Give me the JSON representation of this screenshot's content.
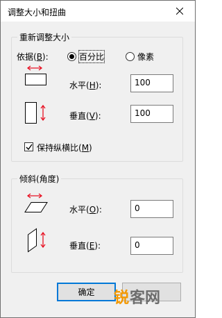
{
  "window": {
    "title": "调整大小和扭曲"
  },
  "resize": {
    "group_title": "重新调整大小",
    "by_label": "依据(B):",
    "by_label_main": "依据(",
    "by_label_key": "B",
    "by_label_tail": "):",
    "percent_label_main": "百分比",
    "pixels_label": "像素",
    "selected": "percent",
    "horizontal_label_main": "水平(",
    "horizontal_label_key": "H",
    "horizontal_label_tail": "):",
    "horizontal_value": "100",
    "vertical_label_main": "垂直(",
    "vertical_label_key": "V",
    "vertical_label_tail": "):",
    "vertical_value": "100",
    "keep_ratio_main": "保持纵横比(",
    "keep_ratio_key": "M",
    "keep_ratio_tail": ")",
    "keep_ratio_checked": true
  },
  "skew": {
    "group_title": "倾斜(角度)",
    "horizontal_label_main": "水平(",
    "horizontal_label_key": "O",
    "horizontal_label_tail": "):",
    "horizontal_value": "0",
    "vertical_label_main": "垂直(",
    "vertical_label_key": "E",
    "vertical_label_tail": "):",
    "vertical_value": "0"
  },
  "buttons": {
    "ok": "确定"
  },
  "watermark": {
    "part1": "锐",
    "part2": "客网"
  },
  "colors": {
    "accent_arrow": "#e81123",
    "primary_border": "#0078d7",
    "watermark_orange": "#f39800",
    "watermark_gray": "#6d6d6d"
  }
}
